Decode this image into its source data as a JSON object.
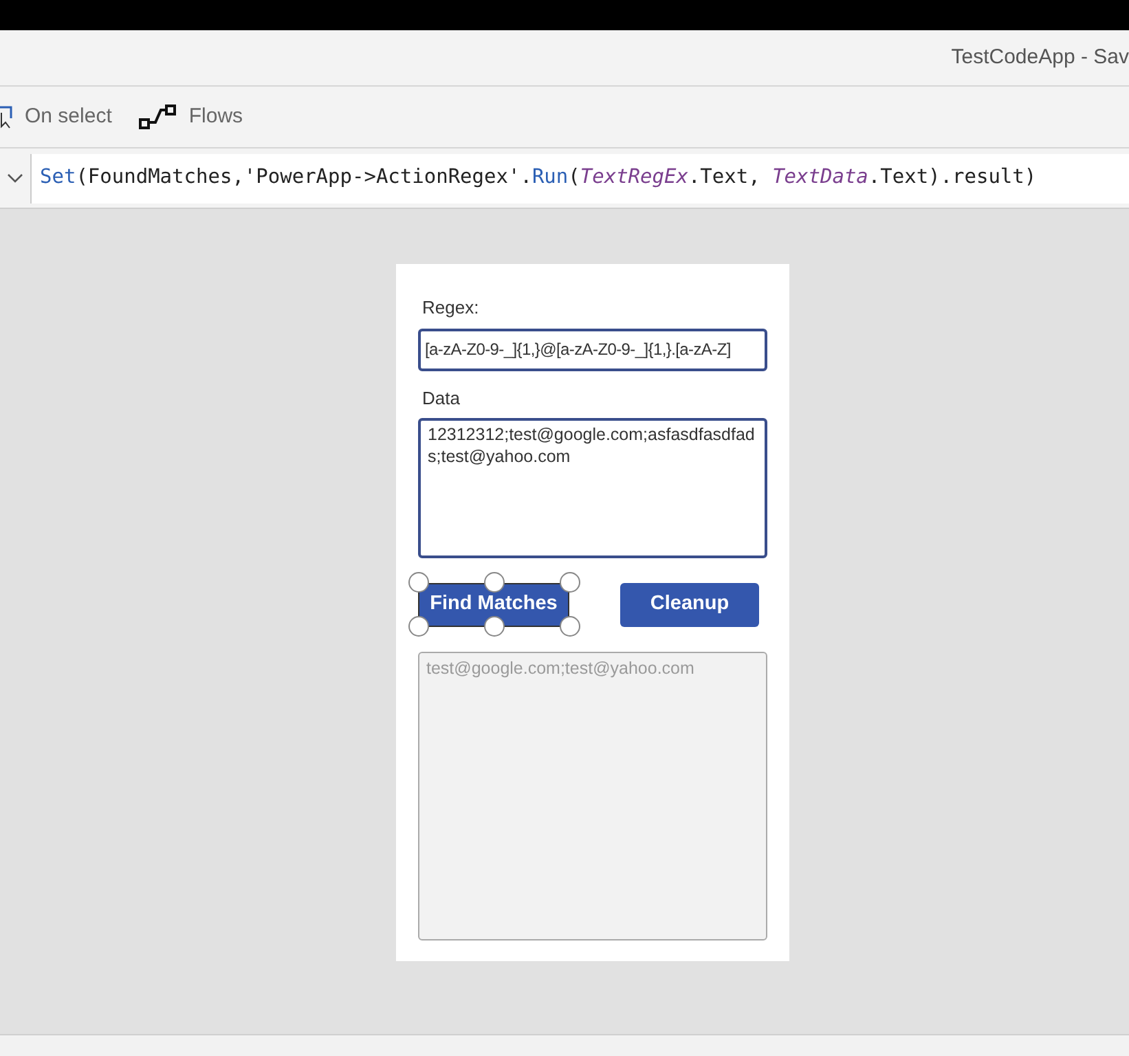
{
  "window": {
    "title": "TestCodeApp - Sav"
  },
  "toolbar": [
    {
      "label": "On select",
      "kind": "select"
    },
    {
      "label": "Flows",
      "kind": "flow"
    }
  ],
  "formula": [
    {
      "text": "Set",
      "kind": "function"
    },
    {
      "text": "(FoundMatches,'PowerApp->ActionRegex'.",
      "kind": "plain"
    },
    {
      "text": "Run",
      "kind": "function"
    },
    {
      "text": "(",
      "kind": "plain"
    },
    {
      "text": "TextRegEx",
      "kind": "control"
    },
    {
      "text": ".Text, ",
      "kind": "plain"
    },
    {
      "text": "TextData",
      "kind": "control"
    },
    {
      "text": ".Text).result)",
      "kind": "plain"
    }
  ],
  "app": {
    "regex_label": "Regex:",
    "regex_value": "[a-zA-Z0-9-_]{1,}@[a-zA-Z0-9-_]{1,}.[a-zA-Z]",
    "data_label": "Data",
    "data_value": "12312312;test@google.com;asfasdfasdfads;test@yahoo.com",
    "buttons": [
      {
        "label": "Find Matches",
        "selected": true
      },
      {
        "label": "Cleanup",
        "selected": false
      }
    ],
    "result_value": "test@google.com;test@yahoo.com"
  }
}
